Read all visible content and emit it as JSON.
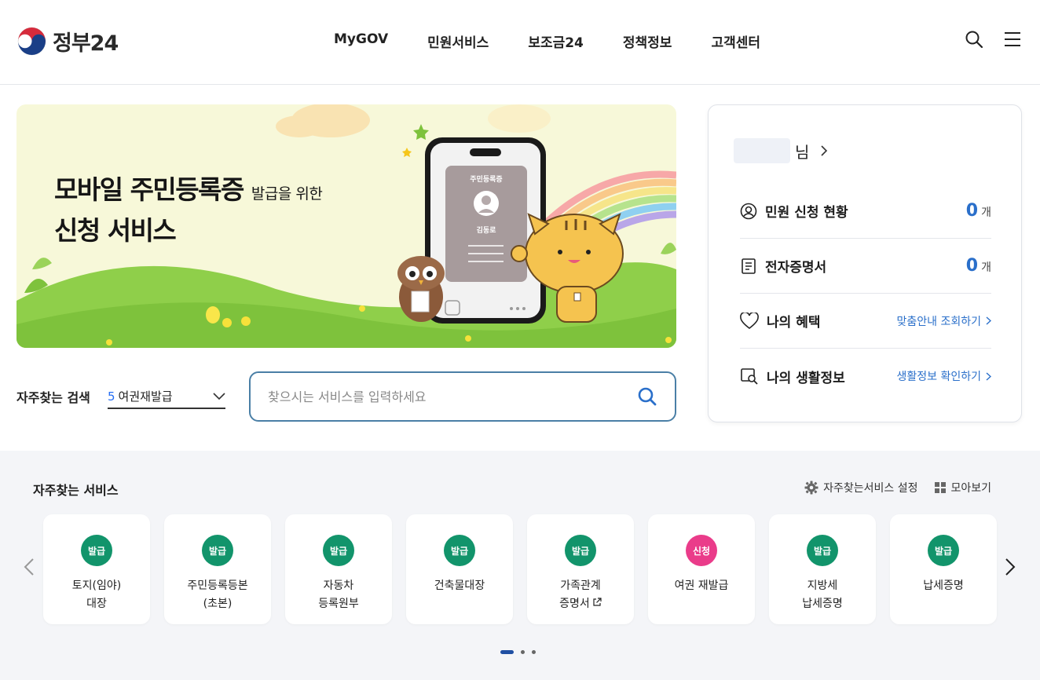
{
  "header": {
    "logo_text": "정부24",
    "nav": [
      "MyGOV",
      "민원서비스",
      "보조금24",
      "정책정보",
      "고객센터"
    ]
  },
  "banner": {
    "title_part1": "모바일 주민등록증",
    "title_small": "발급을 위한",
    "title_line2": "신청 서비스",
    "card_title": "주민등록증",
    "card_name": "김동로"
  },
  "search": {
    "freq_label": "자주찾는 검색",
    "freq_number": "5",
    "freq_value": "여권재발급",
    "placeholder": "찾으시는 서비스를 입력하세요"
  },
  "panel": {
    "user_suffix": "님",
    "rows": [
      {
        "label": "민원 신청 현황",
        "count": "0",
        "unit": "개"
      },
      {
        "label": "전자증명서",
        "count": "0",
        "unit": "개"
      },
      {
        "label": "나의 혜택",
        "link": "맞춤안내 조회하기"
      },
      {
        "label": "나의 생활정보",
        "link": "생활정보 확인하기"
      }
    ]
  },
  "services": {
    "title": "자주찾는 서비스",
    "settings_label": "자주찾는서비스 설정",
    "grid_label": "모아보기",
    "cards": [
      {
        "badge": "발급",
        "name": "토지(임야)\n대장",
        "color": "#12946b"
      },
      {
        "badge": "발급",
        "name": "주민등록등본\n(초본)",
        "color": "#12946b"
      },
      {
        "badge": "발급",
        "name": "자동차\n등록원부",
        "color": "#12946b"
      },
      {
        "badge": "발급",
        "name": "건축물대장",
        "color": "#12946b"
      },
      {
        "badge": "발급",
        "name": "가족관계\n증명서",
        "color": "#12946b",
        "external": true
      },
      {
        "badge": "신청",
        "name": "여권 재발급",
        "color": "#ea3c8a"
      },
      {
        "badge": "발급",
        "name": "지방세\n납세증명",
        "color": "#12946b"
      },
      {
        "badge": "발급",
        "name": "납세증명",
        "color": "#12946b"
      }
    ]
  },
  "colors": {
    "accent_blue": "#2a6fca",
    "issue_green": "#12946b",
    "apply_pink": "#ea3c8a",
    "section_bg": "#f4f5f8"
  }
}
